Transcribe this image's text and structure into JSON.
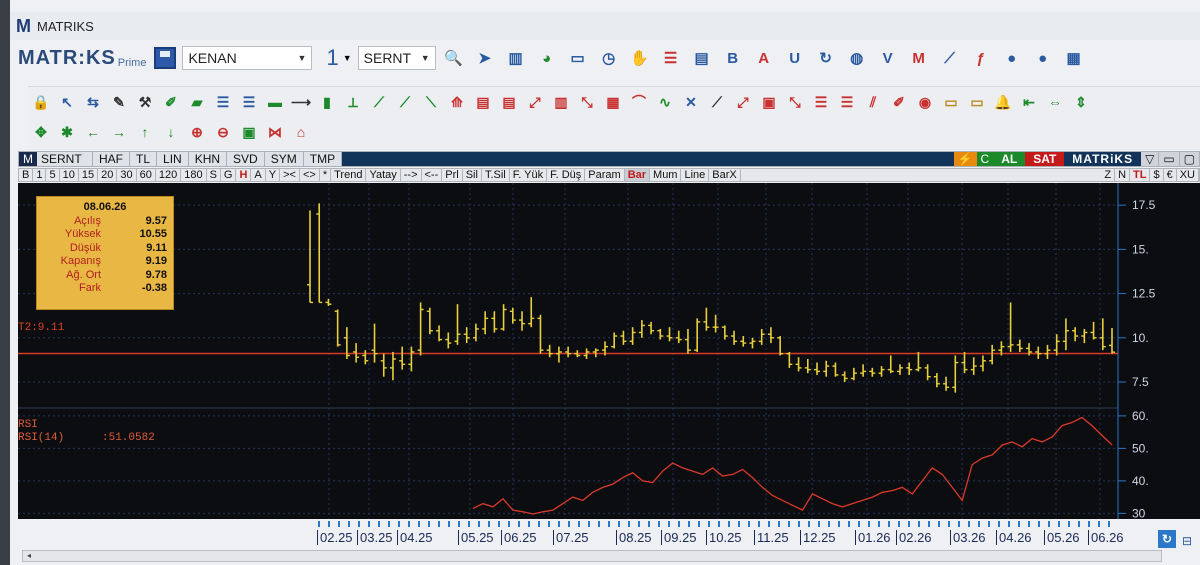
{
  "window": {
    "title": "MATRIKS",
    "logo_letter": "M"
  },
  "toolbar1": {
    "brand": "MATR:KS",
    "brand_sub": "Prime",
    "user_combo": "KENAN",
    "number_combo": "1",
    "symbol_combo": "SERNT",
    "icons": [
      {
        "name": "zoom-icon",
        "glyph": "🔍",
        "color": "#c93030"
      },
      {
        "name": "pointer-icon",
        "glyph": "➤",
        "color": "#2a5aa0"
      },
      {
        "name": "bar-chart-icon",
        "glyph": "▥",
        "color": "#2a5aa0"
      },
      {
        "name": "pie-chart-icon",
        "glyph": "◕",
        "color": "#1c8a2a"
      },
      {
        "name": "monitor-icon",
        "glyph": "▭",
        "color": "#2a5aa0"
      },
      {
        "name": "clock-icon",
        "glyph": "◷",
        "color": "#2a5aa0"
      },
      {
        "name": "handshake-icon",
        "glyph": "✋",
        "color": "#2a5aa0"
      },
      {
        "name": "list-icon",
        "glyph": "☰",
        "color": "#c93030"
      },
      {
        "name": "news-icon",
        "glyph": "▤",
        "color": "#2a5aa0"
      },
      {
        "name": "bold-b-icon",
        "glyph": "B",
        "color": "#2a5aa0"
      },
      {
        "name": "text-a-icon",
        "glyph": "A",
        "color": "#c93030"
      },
      {
        "name": "underline-u-icon",
        "glyph": "U",
        "color": "#2a5aa0"
      },
      {
        "name": "refresh-icon",
        "glyph": "↻",
        "color": "#2a5aa0"
      },
      {
        "name": "globe-icon",
        "glyph": "◍",
        "color": "#2a5aa0"
      },
      {
        "name": "vop-icon",
        "glyph": "V",
        "color": "#2a5aa0"
      },
      {
        "name": "mail-icon",
        "glyph": "M",
        "color": "#c93030"
      },
      {
        "name": "line-chart-icon",
        "glyph": "⟋",
        "color": "#2a5aa0"
      },
      {
        "name": "formula-icon",
        "glyph": "ƒ",
        "color": "#c93030"
      },
      {
        "name": "user-icon",
        "glyph": "●",
        "color": "#2a5aa0"
      },
      {
        "name": "users-icon",
        "glyph": "●",
        "color": "#2a5aa0"
      },
      {
        "name": "settings-icon",
        "glyph": "▦",
        "color": "#2a5aa0"
      }
    ]
  },
  "toolbar2": {
    "row1": [
      {
        "name": "lock-icon",
        "glyph": "🔒",
        "color": "#1c8a2a"
      },
      {
        "name": "arrow-up-left-icon",
        "glyph": "↖",
        "color": "#2a5aa0"
      },
      {
        "name": "swap-icon",
        "glyph": "⇆",
        "color": "#2a5aa0"
      },
      {
        "name": "edit-icon",
        "glyph": "✎",
        "color": "#333333"
      },
      {
        "name": "tools-icon",
        "glyph": "⚒",
        "color": "#333333"
      },
      {
        "name": "pencil-green-icon",
        "glyph": "✐",
        "color": "#1c8a2a"
      },
      {
        "name": "ruler-icon",
        "glyph": "▰",
        "color": "#1c8a2a"
      },
      {
        "name": "align-left-icon",
        "glyph": "☰",
        "color": "#2a5aa0"
      },
      {
        "name": "align-right-icon",
        "glyph": "☰",
        "color": "#2a5aa0"
      },
      {
        "name": "hline-icon",
        "glyph": "▬",
        "color": "#1c8a2a"
      },
      {
        "name": "vision-icon",
        "glyph": "⟶",
        "color": "#333333"
      },
      {
        "name": "vline-icon",
        "glyph": "▮",
        "color": "#1c8a2a"
      },
      {
        "name": "channel-icon",
        "glyph": "⟂",
        "color": "#1c8a2a"
      },
      {
        "name": "trend1-icon",
        "glyph": "⟋",
        "color": "#1c8a2a"
      },
      {
        "name": "trend2-icon",
        "glyph": "⟋",
        "color": "#1c8a2a"
      },
      {
        "name": "trend3-icon",
        "glyph": "⟍",
        "color": "#1c8a2a"
      },
      {
        "name": "fib1-icon",
        "glyph": "⟰",
        "color": "#c93030"
      },
      {
        "name": "fib2-icon",
        "glyph": "▤",
        "color": "#c93030"
      },
      {
        "name": "fib3-icon",
        "glyph": "▤",
        "color": "#c93030"
      },
      {
        "name": "fan1-icon",
        "glyph": "⤢",
        "color": "#c93030"
      },
      {
        "name": "fan2-icon",
        "glyph": "▥",
        "color": "#c93030"
      },
      {
        "name": "fan3-icon",
        "glyph": "⤡",
        "color": "#c93030"
      },
      {
        "name": "grid-icon",
        "glyph": "▦",
        "color": "#c93030"
      },
      {
        "name": "arc-icon",
        "glyph": "⌒",
        "color": "#c93030"
      },
      {
        "name": "wave-icon",
        "glyph": "∿",
        "color": "#1c8a2a"
      },
      {
        "name": "cross-icon",
        "glyph": "✕",
        "color": "#2a5aa0"
      },
      {
        "name": "ray1-icon",
        "glyph": "⟋",
        "color": "#333333"
      },
      {
        "name": "ray2-icon",
        "glyph": "⤢",
        "color": "#c93030"
      },
      {
        "name": "box-icon",
        "glyph": "▣",
        "color": "#c93030"
      },
      {
        "name": "ray3-icon",
        "glyph": "⤡",
        "color": "#c93030"
      },
      {
        "name": "lines-icon",
        "glyph": "☰",
        "color": "#c93030"
      },
      {
        "name": "lines2-icon",
        "glyph": "☰",
        "color": "#c93030"
      },
      {
        "name": "diag-icon",
        "glyph": "⫽",
        "color": "#c93030"
      },
      {
        "name": "pencil-icon",
        "glyph": "✐",
        "color": "#c93030"
      },
      {
        "name": "paint-icon",
        "glyph": "◉",
        "color": "#c93030"
      },
      {
        "name": "comment-icon",
        "glyph": "▭",
        "color": "#b88a20"
      },
      {
        "name": "note-icon",
        "glyph": "▭",
        "color": "#b88a20"
      },
      {
        "name": "bell-icon",
        "glyph": "🔔",
        "color": "#b88a20"
      },
      {
        "name": "shrink-icon",
        "glyph": "⇤",
        "color": "#1c8a2a"
      },
      {
        "name": "expand-h-icon",
        "glyph": "⇔",
        "color": "#1c8a2a"
      },
      {
        "name": "expand-v-icon",
        "glyph": "⇕",
        "color": "#1c8a2a"
      }
    ],
    "row2": [
      {
        "name": "move-icon",
        "glyph": "✥",
        "color": "#1c8a2a"
      },
      {
        "name": "star-icon",
        "glyph": "✱",
        "color": "#1c8a2a"
      },
      {
        "name": "arrow-left-icon",
        "glyph": "←",
        "color": "#1c8a2a"
      },
      {
        "name": "arrow-right-icon",
        "glyph": "→",
        "color": "#1c8a2a"
      },
      {
        "name": "arrow-up-icon",
        "glyph": "↑",
        "color": "#1c8a2a"
      },
      {
        "name": "arrow-down-icon",
        "glyph": "↓",
        "color": "#1c8a2a"
      },
      {
        "name": "zoom-in-icon",
        "glyph": "⊕",
        "color": "#c93030"
      },
      {
        "name": "zoom-out-icon",
        "glyph": "⊖",
        "color": "#c93030"
      },
      {
        "name": "frame-icon",
        "glyph": "▣",
        "color": "#1c8a2a"
      },
      {
        "name": "bowtie-icon",
        "glyph": "⋈",
        "color": "#c93030"
      },
      {
        "name": "arch-icon",
        "glyph": "⌂",
        "color": "#c93030"
      }
    ]
  },
  "chart_header": {
    "symbol": "SERNT",
    "buttons": [
      "HAF",
      "TL",
      "LIN",
      "KHN",
      "SVD",
      "SYM",
      "TMP"
    ],
    "right_c": "C",
    "al": "AL",
    "sat": "SAT",
    "brand": "MATRiKS"
  },
  "period_row": {
    "periods": [
      "B",
      "1",
      "5",
      "10",
      "15",
      "20",
      "30",
      "60",
      "120",
      "180",
      "S",
      "G",
      "H",
      "A",
      "Y"
    ],
    "tools": [
      "><",
      "<>",
      "*",
      "Trend",
      "Yatay",
      "-->",
      "<--",
      "Prl",
      "Sil",
      "T.Sil",
      "F. Yük",
      "F. Düş",
      "Param"
    ],
    "styles": [
      "Bar",
      "Mum",
      "Line",
      "BarX"
    ],
    "right": [
      "Z",
      "N",
      "TL",
      "$",
      "€",
      "XU"
    ]
  },
  "info_box": {
    "date": "08.06.26",
    "rows": [
      {
        "k": "Açılış",
        "v": "9.57"
      },
      {
        "k": "Yüksek",
        "v": "10.55"
      },
      {
        "k": "Düşük",
        "v": "9.11"
      },
      {
        "k": "Kapanış",
        "v": "9.19"
      },
      {
        "k": "Ağ. Ort",
        "v": "9.78"
      },
      {
        "k": "Fark",
        "v": "-0.38"
      }
    ]
  },
  "overlay_label": "T2:9.11",
  "rsi_labels": {
    "title": "RSI",
    "name": "RSI(14)",
    "value": ":51.0582"
  },
  "colors": {
    "chart_bg": "#0c0d10",
    "bar": "#e8d03a",
    "price_line": "#d93a2a",
    "rsi_line": "#d93a2a",
    "grid": "#24355e",
    "axis": "#2a78c8"
  },
  "chart_data": [
    {
      "type": "bar",
      "title": "SERNT",
      "x_tick_labels": [
        "02.25",
        "03.25",
        "04.25",
        "05.25",
        "06.25",
        "07.25",
        "08.25",
        "09.25",
        "10.25",
        "11.25",
        "12.25",
        "01.26",
        "02.26",
        "03.26",
        "04.26",
        "05.26",
        "06.26"
      ],
      "y_ticks": [
        17.5,
        15.0,
        12.5,
        10.0,
        7.5
      ],
      "y_tick_labels": [
        "17.5",
        "15.",
        "12.5",
        "10.",
        "7.5"
      ],
      "ylim": [
        6.2,
        18.3
      ],
      "horizontal_line": 9.11,
      "ohlc": [
        [
          13.0,
          17.2,
          12.0,
          12.0
        ],
        [
          17.0,
          17.6,
          12.0,
          12.0
        ],
        [
          12.0,
          12.2,
          11.8,
          11.9
        ],
        [
          11.5,
          11.6,
          9.5,
          9.6
        ],
        [
          10.0,
          10.6,
          8.8,
          9.0
        ],
        [
          9.2,
          9.7,
          8.6,
          8.9
        ],
        [
          9.0,
          9.3,
          8.5,
          8.7
        ],
        [
          9.3,
          10.8,
          8.6,
          9.1
        ],
        [
          8.7,
          9.1,
          7.8,
          8.3
        ],
        [
          8.3,
          9.2,
          7.6,
          8.8
        ],
        [
          8.7,
          9.5,
          8.2,
          8.5
        ],
        [
          8.5,
          9.5,
          8.1,
          9.2
        ],
        [
          9.3,
          12.0,
          9.0,
          11.6
        ],
        [
          11.5,
          11.7,
          10.2,
          10.4
        ],
        [
          10.4,
          10.7,
          9.8,
          9.9
        ],
        [
          9.9,
          10.3,
          9.4,
          9.7
        ],
        [
          9.8,
          11.9,
          9.6,
          10.2
        ],
        [
          10.2,
          10.6,
          9.7,
          10.0
        ],
        [
          10.0,
          10.8,
          9.8,
          10.5
        ],
        [
          10.5,
          11.5,
          10.2,
          11.1
        ],
        [
          11.1,
          11.5,
          10.3,
          10.5
        ],
        [
          10.5,
          11.9,
          10.4,
          11.6
        ],
        [
          11.5,
          11.7,
          10.8,
          11.0
        ],
        [
          11.0,
          11.5,
          10.4,
          10.8
        ],
        [
          10.8,
          12.3,
          10.6,
          11.1
        ],
        [
          11.1,
          11.3,
          9.1,
          9.3
        ],
        [
          9.3,
          9.6,
          8.9,
          9.1
        ],
        [
          9.1,
          9.5,
          8.6,
          9.2
        ],
        [
          9.2,
          9.5,
          8.9,
          9.1
        ],
        [
          9.1,
          9.3,
          8.9,
          9.0
        ],
        [
          9.0,
          9.4,
          8.8,
          9.2
        ],
        [
          9.2,
          9.4,
          8.9,
          9.3
        ],
        [
          9.3,
          9.8,
          9.0,
          9.5
        ],
        [
          9.5,
          10.3,
          9.4,
          10.1
        ],
        [
          10.1,
          10.4,
          9.6,
          9.8
        ],
        [
          9.8,
          10.6,
          9.6,
          10.3
        ],
        [
          10.3,
          11.0,
          10.0,
          10.7
        ],
        [
          10.7,
          10.9,
          10.2,
          10.4
        ],
        [
          10.4,
          10.5,
          9.9,
          10.1
        ],
        [
          10.1,
          10.6,
          9.8,
          10.0
        ],
        [
          10.0,
          10.4,
          9.7,
          9.9
        ],
        [
          9.9,
          10.5,
          9.1,
          9.3
        ],
        [
          9.3,
          11.1,
          9.2,
          10.9
        ],
        [
          10.9,
          11.7,
          10.4,
          10.6
        ],
        [
          10.6,
          11.3,
          10.3,
          10.6
        ],
        [
          10.6,
          10.7,
          9.9,
          10.1
        ],
        [
          10.1,
          10.4,
          9.6,
          9.8
        ],
        [
          9.8,
          10.1,
          9.5,
          9.7
        ],
        [
          9.7,
          10.0,
          9.4,
          9.8
        ],
        [
          9.8,
          10.5,
          9.6,
          10.2
        ],
        [
          10.2,
          10.6,
          9.7,
          10.0
        ],
        [
          10.0,
          10.1,
          9.0,
          9.1
        ],
        [
          9.1,
          9.2,
          8.3,
          8.5
        ],
        [
          8.5,
          8.9,
          8.1,
          8.3
        ],
        [
          8.3,
          8.8,
          8.0,
          8.2
        ],
        [
          8.2,
          8.6,
          7.9,
          8.1
        ],
        [
          8.1,
          8.7,
          7.8,
          8.4
        ],
        [
          8.4,
          8.6,
          7.8,
          7.9
        ],
        [
          7.9,
          8.1,
          7.5,
          7.7
        ],
        [
          7.7,
          8.3,
          7.6,
          8.0
        ],
        [
          8.0,
          8.5,
          7.8,
          8.1
        ],
        [
          8.1,
          8.3,
          7.8,
          8.0
        ],
        [
          8.0,
          8.4,
          7.8,
          8.2
        ],
        [
          8.2,
          9.0,
          8.0,
          8.1
        ],
        [
          8.1,
          8.5,
          7.9,
          8.3
        ],
        [
          8.3,
          8.6,
          7.9,
          8.2
        ],
        [
          8.2,
          9.2,
          8.1,
          8.3
        ],
        [
          8.3,
          8.5,
          7.6,
          7.8
        ],
        [
          7.8,
          8.0,
          7.2,
          7.4
        ],
        [
          7.4,
          7.8,
          7.0,
          7.2
        ],
        [
          7.2,
          9.0,
          6.9,
          8.6
        ],
        [
          8.6,
          9.2,
          8.0,
          8.2
        ],
        [
          8.2,
          8.9,
          7.9,
          8.4
        ],
        [
          8.4,
          9.0,
          8.1,
          8.7
        ],
        [
          8.7,
          9.6,
          8.5,
          9.3
        ],
        [
          9.3,
          9.8,
          9.0,
          9.5
        ],
        [
          9.5,
          12.0,
          9.2,
          9.6
        ],
        [
          9.6,
          9.9,
          9.2,
          9.4
        ],
        [
          9.4,
          9.7,
          9.0,
          9.2
        ],
        [
          9.2,
          9.5,
          8.8,
          9.1
        ],
        [
          9.1,
          9.6,
          8.8,
          9.3
        ],
        [
          9.3,
          10.2,
          9.0,
          9.8
        ],
        [
          9.8,
          11.1,
          9.3,
          10.4
        ],
        [
          10.4,
          10.6,
          9.8,
          10.1
        ],
        [
          10.1,
          10.5,
          9.7,
          10.3
        ],
        [
          10.3,
          10.9,
          9.9,
          10.0
        ],
        [
          10.0,
          11.1,
          9.3,
          9.5
        ],
        [
          9.57,
          10.55,
          9.11,
          9.19
        ]
      ]
    },
    {
      "type": "line",
      "title": "RSI",
      "y_ticks": [
        60,
        50,
        40,
        30
      ],
      "y_tick_labels": [
        "60.",
        "50.",
        "40.",
        "30"
      ],
      "ylim": [
        29.5,
        61.5
      ],
      "series": [
        {
          "name": "RSI(14)",
          "values": [
            31.5,
            33.0,
            32.0,
            34.5,
            31.0,
            30.5,
            29.8,
            30.5,
            31.0,
            33.0,
            35.0,
            34.0,
            36.5,
            38.0,
            39.0,
            41.0,
            42.5,
            40.0,
            39.5,
            43.0,
            45.5,
            44.0,
            43.0,
            42.0,
            44.0,
            41.5,
            42.0,
            43.5,
            41.0,
            38.0,
            35.5,
            34.0,
            32.5,
            31.0,
            36.0,
            34.5,
            33.0,
            32.0,
            33.0,
            34.0,
            35.0,
            36.5,
            37.0,
            38.0,
            36.0,
            40.0,
            44.0,
            42.0,
            38.0,
            34.0,
            45.0,
            47.0,
            48.0,
            51.0,
            52.0,
            50.5,
            53.0,
            52.0,
            53.5,
            57.0,
            58.0,
            59.5,
            57.0,
            54.0,
            51.06
          ]
        }
      ]
    }
  ],
  "x_axis_labels": [
    "02.25",
    "03.25",
    "04.25",
    "05.25",
    "06.25",
    "07.25",
    "08.25",
    "09.25",
    "10.25",
    "11.25",
    "12.25",
    "01.26",
    "02.26",
    "03.26",
    "04.26",
    "05.26",
    "06.26"
  ]
}
